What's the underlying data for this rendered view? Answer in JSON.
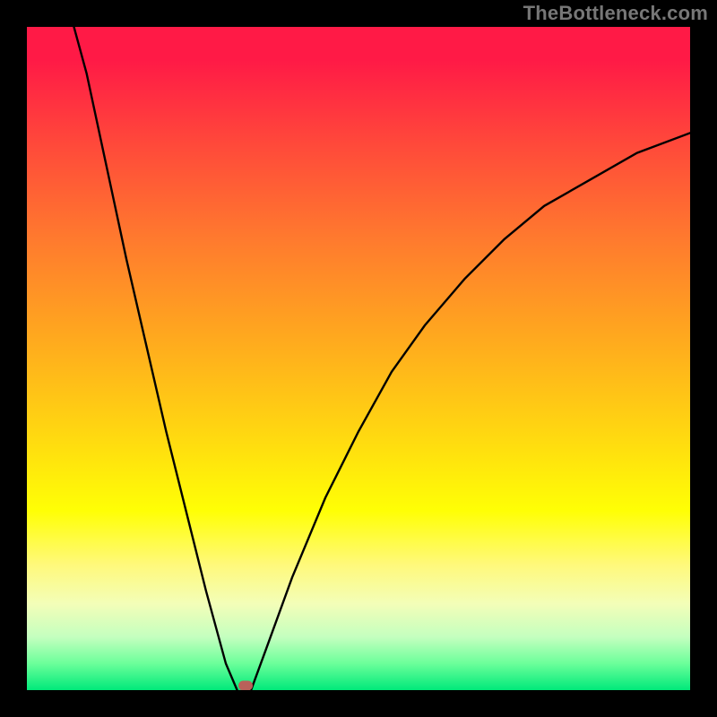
{
  "watermark": "TheBottleneck.com",
  "colors": {
    "frame_background": "#000000",
    "gradient_stops": [
      {
        "stop": 0.0,
        "color": "#ff1a46"
      },
      {
        "stop": 0.05,
        "color": "#ff1a46"
      },
      {
        "stop": 0.18,
        "color": "#ff4a3a"
      },
      {
        "stop": 0.32,
        "color": "#ff7a2e"
      },
      {
        "stop": 0.46,
        "color": "#ffa61f"
      },
      {
        "stop": 0.6,
        "color": "#ffd312"
      },
      {
        "stop": 0.73,
        "color": "#ffff05"
      },
      {
        "stop": 0.81,
        "color": "#fff97a"
      },
      {
        "stop": 0.87,
        "color": "#f3feb8"
      },
      {
        "stop": 0.92,
        "color": "#c4ffbf"
      },
      {
        "stop": 0.96,
        "color": "#6bff9a"
      },
      {
        "stop": 1.0,
        "color": "#00e97a"
      }
    ],
    "curve_stroke": "#000000",
    "marker_fill": "#b9615a"
  },
  "chart_data": {
    "type": "line",
    "title": "",
    "xlabel": "",
    "ylabel": "",
    "xlim": [
      0,
      100
    ],
    "ylim": [
      0,
      100
    ],
    "grid": false,
    "series": [
      {
        "name": "left-branch",
        "x": [
          6,
          9,
          12,
          15,
          18,
          21,
          24,
          27,
          30,
          31.7
        ],
        "y": [
          104,
          93,
          79,
          65,
          52,
          39,
          27,
          15,
          4,
          0
        ]
      },
      {
        "name": "right-branch",
        "x": [
          33.8,
          36,
          40,
          45,
          50,
          55,
          60,
          66,
          72,
          78,
          85,
          92,
          100
        ],
        "y": [
          0,
          6,
          17,
          29,
          39,
          48,
          55,
          62,
          68,
          73,
          77,
          81,
          84
        ]
      }
    ],
    "marker": {
      "x": 33,
      "y": 0.7
    },
    "annotations": []
  }
}
